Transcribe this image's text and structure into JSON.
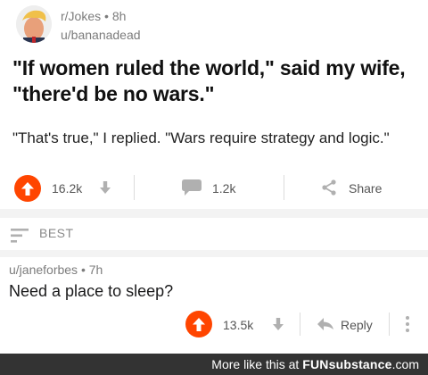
{
  "post": {
    "subreddit": "r/Jokes",
    "age": "8h",
    "author": "u/bananadead",
    "title": "\"If women ruled the world,\" said my wife, \"there'd be no wars.\"",
    "body": "\"That's true,\" I replied. \"Wars require strategy and logic.\"",
    "upvotes": "16.2k",
    "comments": "1.2k",
    "share_label": "Share"
  },
  "sort": {
    "label": "BEST"
  },
  "comment": {
    "author": "u/janeforbes",
    "age": "7h",
    "text": "Need a place to sleep?",
    "upvotes": "13.5k",
    "reply_label": "Reply"
  },
  "watermark": {
    "prefix": "More like this at ",
    "brand_a": "FUN",
    "brand_b": "substance",
    "suffix": ".com"
  },
  "colors": {
    "upvote": "#ff4500",
    "meta_gray": "#7c7c7c",
    "footer_bg": "#333333"
  },
  "icons": [
    "upvote-icon",
    "downvote-icon",
    "comment-icon",
    "share-icon",
    "sort-icon",
    "reply-icon",
    "more-icon"
  ]
}
